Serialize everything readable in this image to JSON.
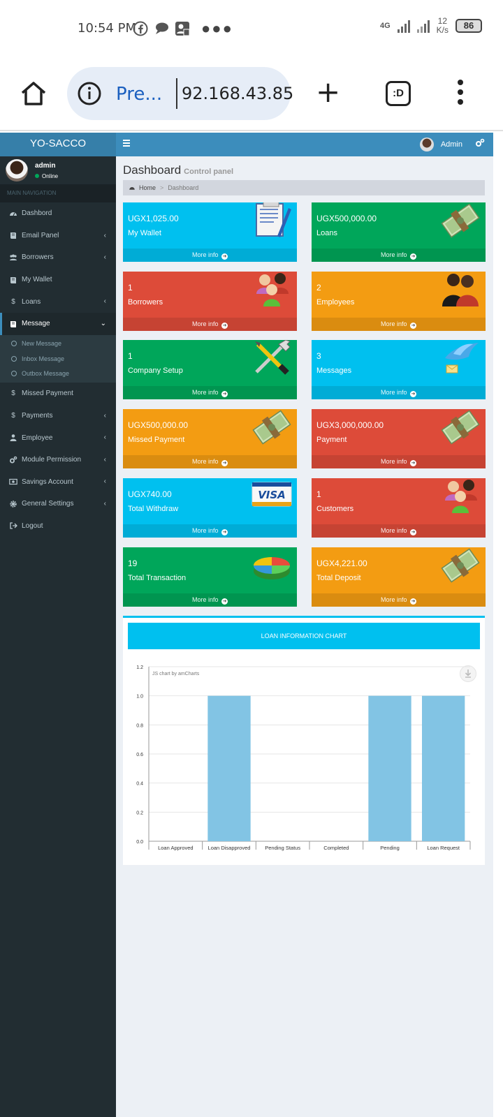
{
  "status_bar": {
    "time": "10:54 PM",
    "network": "4G",
    "speed_value": "12",
    "speed_unit": "K/s",
    "battery": "86"
  },
  "browser": {
    "page_title": "Pre...",
    "host": "92.168.43.85",
    "tabs_label": ":D"
  },
  "app": {
    "logo": "YO-SACCO",
    "nav_user_name": "Admin"
  },
  "sidebar": {
    "user_name": "admin",
    "user_status": "Online",
    "header": "MAIN NAVIGATION",
    "items": [
      {
        "label": "Dashbord",
        "icon": "dashboard-icon"
      },
      {
        "label": "Email Panel",
        "icon": "book-icon"
      },
      {
        "label": "Borrowers",
        "icon": "users-icon"
      },
      {
        "label": "My Wallet",
        "icon": "book-icon"
      },
      {
        "label": "Loans",
        "icon": "dollar-icon"
      },
      {
        "label": "Message",
        "icon": "book-icon"
      },
      {
        "label": "Missed Payment",
        "icon": "dollar-icon"
      },
      {
        "label": "Payments",
        "icon": "dollar-icon"
      },
      {
        "label": "Employee",
        "icon": "user-icon"
      },
      {
        "label": "Module Permission",
        "icon": "gears-icon"
      },
      {
        "label": "Savings Account",
        "icon": "money-icon"
      },
      {
        "label": "General Settings",
        "icon": "gear-icon"
      },
      {
        "label": "Logout",
        "icon": "sign-out-icon"
      }
    ],
    "submenu": [
      "New Message",
      "Inbox Message",
      "Outbox Message"
    ]
  },
  "content": {
    "title": "Dashboard",
    "subtitle": "Control panel",
    "breadcrumb_home": "Home",
    "breadcrumb_current": "Dashboard",
    "more_info": "More info",
    "boxes": [
      {
        "value": "UGX1,025.00",
        "label": "My Wallet",
        "color": "#00c0ef",
        "icon": "document-icon"
      },
      {
        "value": "UGX500,000.00",
        "label": "Loans",
        "color": "#00a65a",
        "icon": "money-stack-icon"
      },
      {
        "value": "1",
        "label": "Borrowers",
        "color": "#dd4b39",
        "icon": "people-group-icon"
      },
      {
        "value": "2",
        "label": "Employees",
        "color": "#f39c12",
        "icon": "people-pair-icon"
      },
      {
        "value": "1",
        "label": "Company Setup",
        "color": "#00a65a",
        "icon": "tools-icon"
      },
      {
        "value": "3",
        "label": "Messages",
        "color": "#00c0ef",
        "icon": "bird-mail-icon"
      },
      {
        "value": "UGX500,000.00",
        "label": "Missed Payment",
        "color": "#f39c12",
        "icon": "money-stack-icon"
      },
      {
        "value": "UGX3,000,000.00",
        "label": "Payment",
        "color": "#dd4b39",
        "icon": "money-stack-icon"
      },
      {
        "value": "UGX740.00",
        "label": "Total Withdraw",
        "color": "#00c0ef",
        "icon": "visa-card-icon"
      },
      {
        "value": "1",
        "label": "Customers",
        "color": "#dd4b39",
        "icon": "people-group-icon"
      },
      {
        "value": "19",
        "label": "Total Transaction",
        "color": "#00a65a",
        "icon": "pie-chart-icon"
      },
      {
        "value": "UGX4,221.00",
        "label": "Total Deposit",
        "color": "#f39c12",
        "icon": "money-stack-icon"
      }
    ],
    "chart_heading": "LOAN INFORMATION CHART",
    "chart_credit": "JS chart by amCharts"
  },
  "chart_data": {
    "type": "bar",
    "categories": [
      "Loan Approved",
      "Loan Disapproved",
      "Pending Status",
      "Completed",
      "Pending",
      "Loan Request"
    ],
    "values": [
      0,
      1,
      0,
      0,
      1,
      1
    ],
    "ylim": [
      0,
      1.2
    ],
    "yticks": [
      "0.0",
      "0.2",
      "0.4",
      "0.6",
      "0.8",
      "1.0",
      "1.2"
    ],
    "bar_color": "#82c4e4",
    "grid": true
  }
}
